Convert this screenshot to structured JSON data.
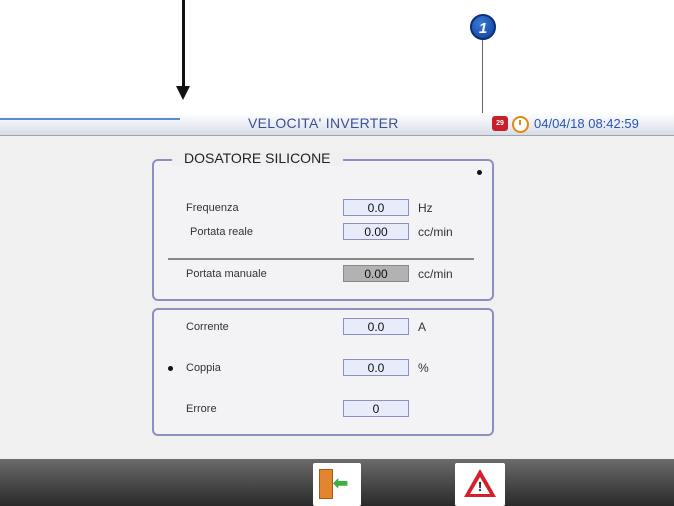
{
  "annotation": {
    "callout_number": "1"
  },
  "header": {
    "title": "VELOCITA' INVERTER",
    "phone_icon": "phone-icon",
    "phone_badge": "29",
    "clock_icon": "clock-icon",
    "datetime": "04/04/18 08:42:59"
  },
  "panel1": {
    "title": "DOSATORE SILICONE",
    "rows": [
      {
        "label": "Frequenza",
        "value": "0.0",
        "unit": "Hz"
      },
      {
        "label": "Portata reale",
        "value": "0.00",
        "unit": "cc/min"
      },
      {
        "label": "Portata manuale",
        "value": "0.00",
        "unit": "cc/min"
      }
    ]
  },
  "panel2": {
    "rows": [
      {
        "label": "Corrente",
        "value": "0.0",
        "unit": "A"
      },
      {
        "label": "Coppia",
        "value": "0.0",
        "unit": "%"
      },
      {
        "label": "Errore",
        "value": "0",
        "unit": ""
      }
    ]
  },
  "footer": {
    "exit_icon": "exit-door-icon",
    "alarm_icon": "alarm-warning-icon"
  },
  "colors": {
    "title": "#3a4f9a",
    "datetime": "#2a55b8",
    "panel_border": "#8d8fc2",
    "alarm": "#d61f2a"
  }
}
